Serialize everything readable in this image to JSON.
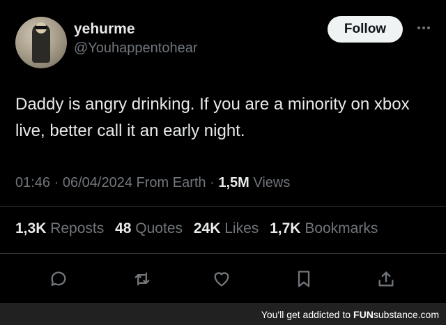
{
  "user": {
    "display_name": "yehurme",
    "handle": "@Youhappentohear",
    "avatar_icon": "profile-avatar"
  },
  "follow_button": {
    "label": "Follow"
  },
  "more_icon": "ellipsis-icon",
  "tweet": {
    "text": "Daddy is angry drinking. If you are a minority on xbox live, better call it an early night."
  },
  "meta": {
    "time": "01:46",
    "separator": " · ",
    "date": "06/04/2024",
    "location": "From Earth",
    "views_count": "1,5M",
    "views_label": "Views"
  },
  "stats": {
    "reposts_count": "1,3K",
    "reposts_label": "Reposts",
    "quotes_count": "48",
    "quotes_label": "Quotes",
    "likes_count": "24K",
    "likes_label": "Likes",
    "bookmarks_count": "1,7K",
    "bookmarks_label": "Bookmarks"
  },
  "actions": [
    "reply-icon",
    "repost-icon",
    "like-icon",
    "bookmark-icon",
    "share-icon"
  ],
  "footer": {
    "text": "You'll get addicted to",
    "brand_prefix": "FUN",
    "brand_suffix": "substance.com"
  },
  "colors": {
    "background": "#000000",
    "primary_text": "#e7e9ea",
    "secondary_text": "#71767b",
    "divider": "#2f3336",
    "follow_bg": "#eff3f4",
    "footer_bg": "#212121"
  }
}
